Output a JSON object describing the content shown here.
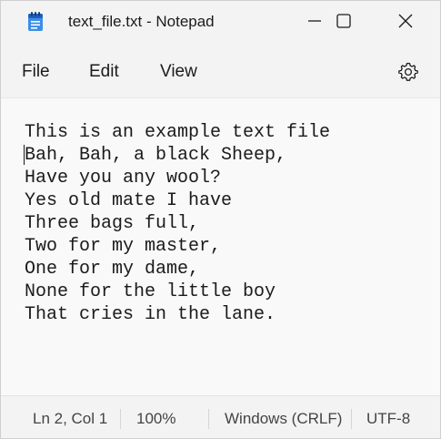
{
  "window": {
    "title": "text_file.txt - Notepad",
    "app_icon": "notepad-icon",
    "controls": {
      "minimize_icon": "minimize-icon",
      "maximize_icon": "maximize-icon",
      "close_icon": "close-icon"
    }
  },
  "menu": {
    "items": [
      {
        "label": "File"
      },
      {
        "label": "Edit"
      },
      {
        "label": "View"
      }
    ],
    "settings_icon": "gear-icon"
  },
  "editor": {
    "lines": [
      "This is an example text file",
      "Bah, Bah, a black Sheep,",
      "Have you any wool?",
      "Yes old mate I have",
      "Three bags full,",
      "Two for my master,",
      "One for my dame,",
      "None for the little boy",
      "That cries in the lane."
    ],
    "caret_line": 2,
    "caret_col": 1
  },
  "status": {
    "position": "Ln 2, Col 1",
    "zoom": "100%",
    "line_ending": "Windows (CRLF)",
    "encoding": "UTF-8"
  },
  "colors": {
    "chrome_bg": "#f3f3f3",
    "editor_bg": "#f9f9f9",
    "text": "#1b1b1b",
    "icon_blue": "#2b7de9"
  }
}
